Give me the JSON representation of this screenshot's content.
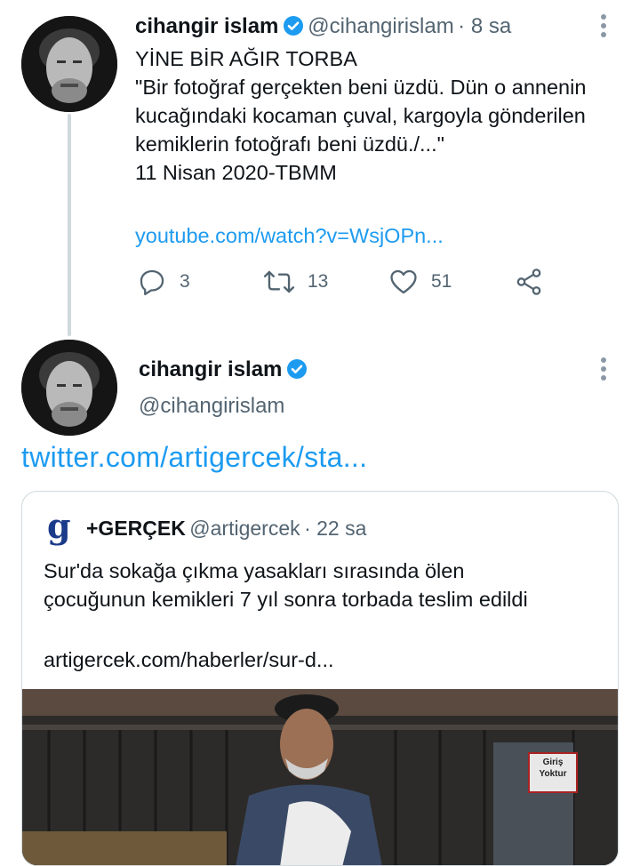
{
  "tweet1": {
    "name": "cihangir islam",
    "handle": "@cihangirislam",
    "time": "· 8 sa",
    "lines": [
      "YİNE BİR AĞIR TORBA",
      "\"Bir fotoğraf gerçekten beni üzdü. Dün o annenin",
      "kucağındaki kocaman çuval, kargoyla gönderilen",
      "kemiklerin fotoğrafı beni üzdü./...\"",
      "11 Nisan 2020-TBMM"
    ],
    "link": "youtube.com/watch?v=WsjOPn...",
    "actions": {
      "reply_icon": "reply-icon",
      "replies": "3",
      "retweet_icon": "retweet-icon",
      "retweets": "13",
      "like_icon": "heart-icon",
      "likes": "51",
      "share_icon": "share-icon"
    }
  },
  "tweet2": {
    "name": "cihangir islam",
    "handle": "@cihangirislam",
    "link": "twitter.com/artigercek/sta..."
  },
  "quote": {
    "logo_letter": "g",
    "name": "+GERÇEK",
    "handle": "@artigercek",
    "time": "· 22 sa",
    "lines": [
      "Sur'da sokağa çıkma yasakları sırasında ölen",
      "çocuğunun kemikleri 7 yıl sonra torbada teslim edildi"
    ],
    "link": "artigercek.com/haberler/sur-d...",
    "photo_sign": [
      "Giriş",
      "Yoktur"
    ]
  },
  "colors": {
    "accent": "#1d9bf0",
    "verified": "#1d9bf0",
    "muted": "#536471",
    "logo": "#1a3a8a"
  }
}
